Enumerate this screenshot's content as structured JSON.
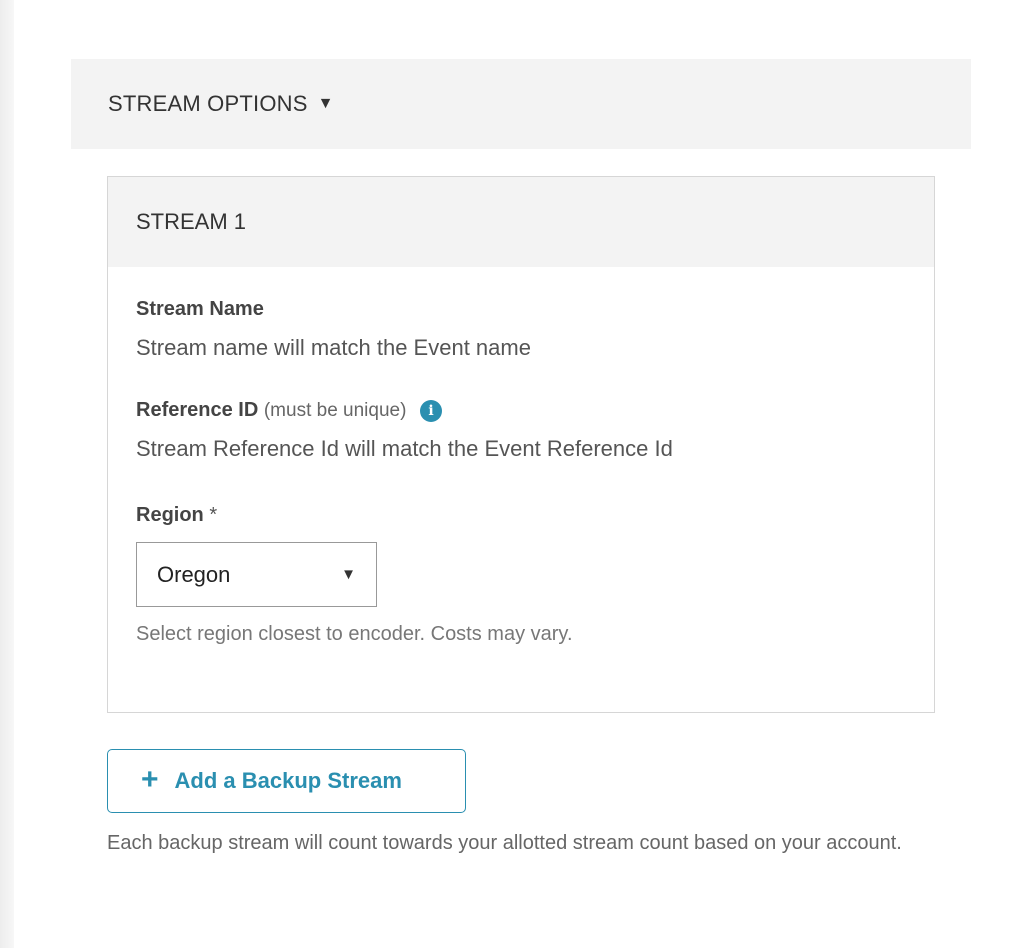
{
  "section": {
    "title": "STREAM OPTIONS",
    "caret_icon": "caret-down-icon"
  },
  "stream": {
    "title": "STREAM 1",
    "name_label": "Stream Name",
    "name_value": "Stream name will match the Event name",
    "ref_label": "Reference ID",
    "ref_hint": "(must be unique)",
    "ref_info_icon": "i",
    "ref_value": "Stream Reference Id will match the Event Reference Id",
    "region_label": "Region",
    "region_required": "*",
    "region_selected": "Oregon",
    "region_hint": "Select region closest to encoder. Costs may vary."
  },
  "backup": {
    "plus": "+",
    "label": "Add a Backup Stream",
    "note": "Each backup stream will count towards your allotted stream count based on your account."
  },
  "colors": {
    "accent": "#2a8fb0",
    "panel_bg": "#f3f3f3",
    "border": "#d6d6d6"
  }
}
